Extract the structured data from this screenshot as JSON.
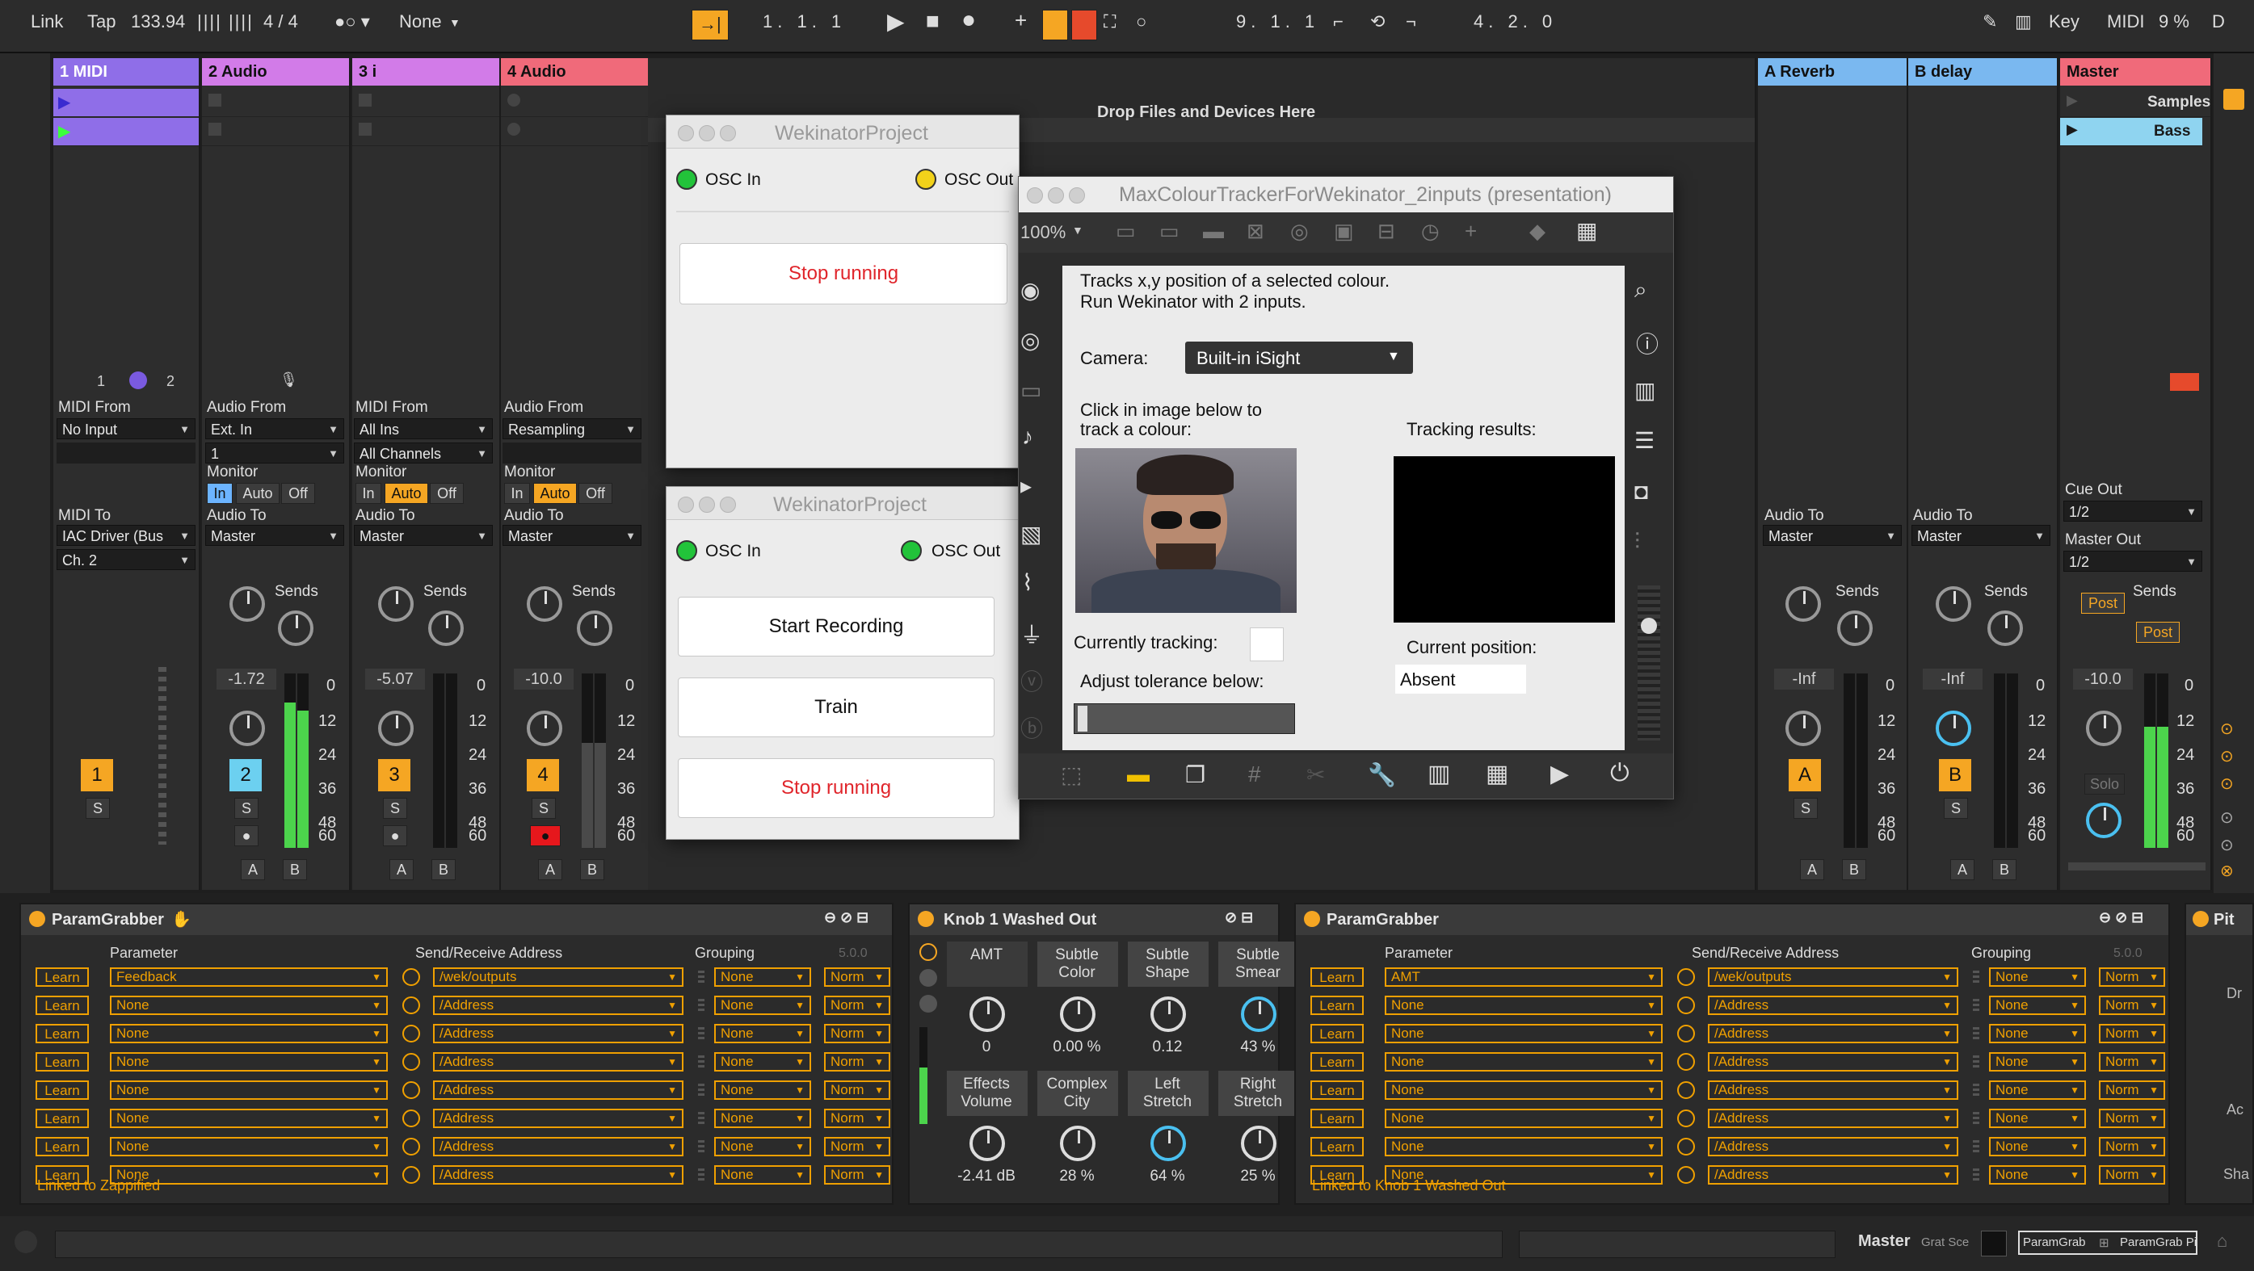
{
  "topbar": {
    "link": "Link",
    "tap": "Tap",
    "tempo": "133.94",
    "time_sig": "4 / 4",
    "quantize": "None",
    "position": "1.   1.   1",
    "loop_start": "9.   1.   1",
    "loop_length": "4.   2.   0",
    "key": "Key",
    "midi": "MIDI",
    "cpu": "9 %",
    "d": "D"
  },
  "tracks": [
    {
      "name": "1 MIDI",
      "color": "#8f6ee8",
      "input_label": "MIDI From",
      "input": "No Input",
      "output_label": "MIDI To",
      "output": "IAC Driver (Bus",
      "output2": "Ch. 2",
      "num": "1",
      "volume": ""
    },
    {
      "name": "2 Audio",
      "color": "#d27be8",
      "input_label": "Audio From",
      "input": "Ext. In",
      "input2": "1",
      "monitor_label": "Monitor",
      "output_label": "Audio To",
      "output": "Master",
      "num": "2",
      "volume": "-1.72"
    },
    {
      "name": "3 i",
      "color": "#d27be8",
      "input_label": "MIDI From",
      "input": "All Ins",
      "input2": "All Channels",
      "monitor_label": "Monitor",
      "output_label": "Audio To",
      "output": "Master",
      "num": "3",
      "volume": "-5.07"
    },
    {
      "name": "4 Audio",
      "color": "#f06a7a",
      "input_label": "Audio From",
      "input": "Resampling",
      "monitor_label": "Monitor",
      "output_label": "Audio To",
      "output": "Master",
      "num": "4",
      "volume": "-10.0"
    }
  ],
  "monitor": {
    "in": "In",
    "auto": "Auto",
    "off": "Off"
  },
  "returns": [
    {
      "name": "A Reverb",
      "color": "#7ab8f0",
      "output_label": "Audio To",
      "output": "Master",
      "num": "A",
      "volume": "-Inf"
    },
    {
      "name": "B delay",
      "color": "#7ab8f0",
      "output_label": "Audio To",
      "output": "Master",
      "num": "B",
      "volume": "-Inf"
    }
  ],
  "master": {
    "name": "Master",
    "color": "#f06a7a",
    "clip1": "Samples",
    "clip2": "Bass",
    "cue_label": "Cue Out",
    "cue": "1/2",
    "master_out_label": "Master Out",
    "master_out": "1/2",
    "volume": "-10.0",
    "post": "Post",
    "solo": "Solo"
  },
  "drop_text": "Drop Files and Devices Here",
  "sends_label": "Sends",
  "solo_label": "S",
  "send_a": "A",
  "send_b": "B",
  "db_scale": [
    "0",
    "12",
    "24",
    "36",
    "48",
    "60"
  ],
  "wek1": {
    "title": "WekinatorProject",
    "osc_in": "OSC In",
    "osc_out": "OSC Out",
    "stop": "Stop running",
    "osc_in_color": "#22c33a",
    "osc_out_color": "#f2d21a"
  },
  "wek2": {
    "title": "WekinatorProject",
    "osc_in": "OSC In",
    "osc_out": "OSC Out",
    "start_rec": "Start Recording",
    "train": "Train",
    "stop": "Stop running",
    "osc_in_color": "#22c33a",
    "osc_out_color": "#22c33a"
  },
  "max": {
    "title": "MaxColourTrackerForWekinator_2inputs (presentation)",
    "zoom": "100%",
    "desc1": "Tracks x,y position of a selected colour.",
    "desc2": "Run Wekinator with 2 inputs.",
    "camera_label": "Camera:",
    "camera": "Built-in iSight",
    "click_label1": "Click in image below to",
    "click_label2": "track a colour:",
    "tracking_results": "Tracking results:",
    "currently_tracking": "Currently tracking:",
    "current_position": "Current position:",
    "position_value": "Absent",
    "adjust_tolerance": "Adjust tolerance below:"
  },
  "device1": {
    "title": "ParamGrabber",
    "col_param": "Parameter",
    "col_addr": "Send/Receive Address",
    "col_group": "Grouping",
    "version": "5.0.0",
    "learn": "Learn",
    "rows": [
      {
        "param": "Feedback",
        "addr": "/wek/outputs",
        "group": "None",
        "norm": "Norm"
      },
      {
        "param": "None",
        "addr": "/Address",
        "group": "None",
        "norm": "Norm"
      },
      {
        "param": "None",
        "addr": "/Address",
        "group": "None",
        "norm": "Norm"
      },
      {
        "param": "None",
        "addr": "/Address",
        "group": "None",
        "norm": "Norm"
      },
      {
        "param": "None",
        "addr": "/Address",
        "group": "None",
        "norm": "Norm"
      },
      {
        "param": "None",
        "addr": "/Address",
        "group": "None",
        "norm": "Norm"
      },
      {
        "param": "None",
        "addr": "/Address",
        "group": "None",
        "norm": "Norm"
      },
      {
        "param": "None",
        "addr": "/Address",
        "group": "None",
        "norm": "Norm"
      }
    ],
    "footer": "Linked to Zappified"
  },
  "rack": {
    "title": "Knob 1 Washed Out",
    "macros": [
      {
        "label1": "AMT",
        "label2": "",
        "value": "0"
      },
      {
        "label1": "Subtle",
        "label2": "Color",
        "value": "0.00 %"
      },
      {
        "label1": "Subtle",
        "label2": "Shape",
        "value": "0.12"
      },
      {
        "label1": "Subtle",
        "label2": "Smear",
        "value": "43 %"
      },
      {
        "label1": "Effects",
        "label2": "Volume",
        "value": "-2.41 dB"
      },
      {
        "label1": "Complex",
        "label2": "City",
        "value": "28 %"
      },
      {
        "label1": "Left",
        "label2": "Stretch",
        "value": "64 %"
      },
      {
        "label1": "Right",
        "label2": "Stretch",
        "value": "25 %"
      }
    ]
  },
  "device2": {
    "title": "ParamGrabber",
    "col_param": "Parameter",
    "col_addr": "Send/Receive Address",
    "col_group": "Grouping",
    "version": "5.0.0",
    "learn": "Learn",
    "rows": [
      {
        "param": "AMT",
        "addr": "/wek/outputs",
        "group": "None",
        "norm": "Norm"
      },
      {
        "param": "None",
        "addr": "/Address",
        "group": "None",
        "norm": "Norm"
      },
      {
        "param": "None",
        "addr": "/Address",
        "group": "None",
        "norm": "Norm"
      },
      {
        "param": "None",
        "addr": "/Address",
        "group": "None",
        "norm": "Norm"
      },
      {
        "param": "None",
        "addr": "/Address",
        "group": "None",
        "norm": "Norm"
      },
      {
        "param": "None",
        "addr": "/Address",
        "group": "None",
        "norm": "Norm"
      },
      {
        "param": "None",
        "addr": "/Address",
        "group": "None",
        "norm": "Norm"
      },
      {
        "param": "None",
        "addr": "/Address",
        "group": "None",
        "norm": "Norm"
      }
    ],
    "footer": "Linked to Knob 1 Washed Out"
  },
  "device3": {
    "title": "Pit",
    "labels": [
      "Dr",
      "Ac",
      "Sha"
    ]
  },
  "statusbar": {
    "master": "Master",
    "chain": "Grat Sce",
    "tab1": "ParamGrab",
    "tab2": "ParamGrab Pi"
  }
}
